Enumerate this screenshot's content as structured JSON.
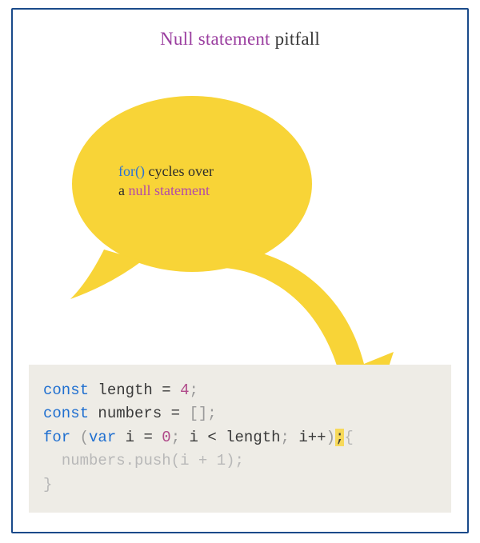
{
  "title": {
    "accent": "Null statement",
    "rest": " pitfall"
  },
  "bubble": {
    "line1_kw": "for()",
    "line1_rest": " cycles over",
    "line2_pre": "a ",
    "line2_kw": "null statement"
  },
  "code": {
    "l1": {
      "kw": "const",
      "sp1": " ",
      "id": "length",
      "sp2": " ",
      "eq": "=",
      "sp3": " ",
      "num": "4",
      "semi": ";"
    },
    "l2": {
      "kw": "const",
      "sp1": " ",
      "id": "numbers",
      "sp2": " ",
      "eq": "=",
      "sp3": " ",
      "br": "[]",
      "semi": ";"
    },
    "l3": {
      "kw": "for",
      "sp1": " ",
      "open": "(",
      "var": "var",
      "sp2": " ",
      "i": "i",
      "sp3": " ",
      "eq": "=",
      "sp4": " ",
      "zero": "0",
      "semi1": ";",
      "sp5": " ",
      "i2": "i",
      "sp6": " ",
      "lt": "<",
      "sp7": " ",
      "len": "length",
      "semi2": ";",
      "sp8": " ",
      "i3": "i",
      "pp": "++",
      "close": ")",
      "hlsemi": ";",
      "brace": "{"
    },
    "l4": {
      "indent": "  ",
      "obj": "numbers",
      "dot": ".",
      "method": "push",
      "open": "(",
      "i": "i",
      "sp1": " ",
      "plus": "+",
      "sp2": " ",
      "one": "1",
      "close": ")",
      "semi": ";"
    },
    "l5": {
      "brace": "}"
    }
  }
}
